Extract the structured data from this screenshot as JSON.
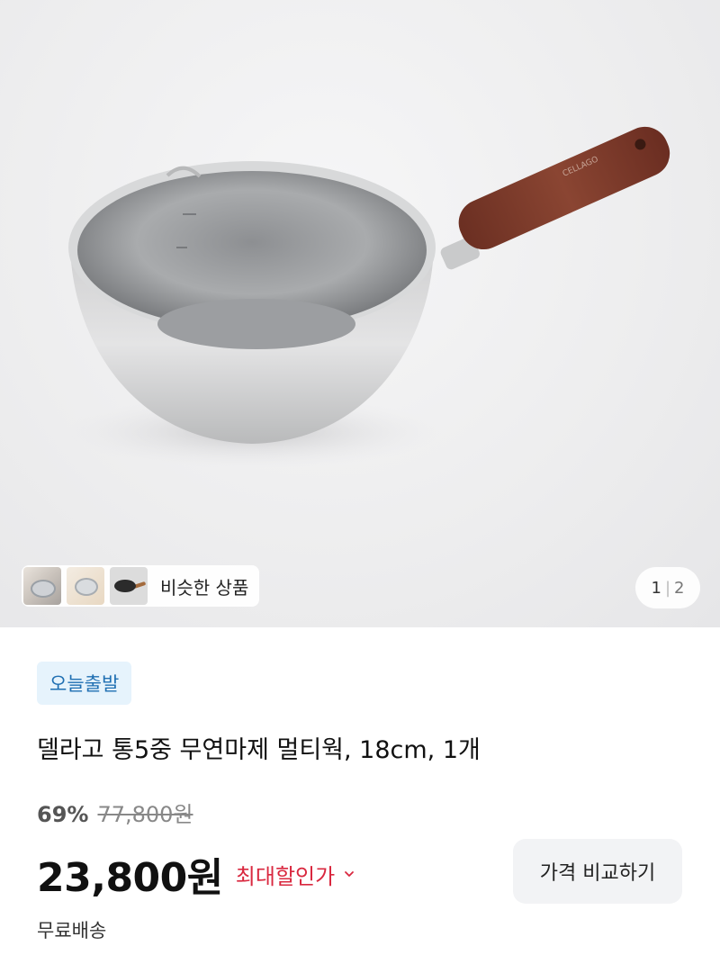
{
  "gallery": {
    "similar_label": "비슷한 상품",
    "pager": {
      "current": "1",
      "separator": "|",
      "total": "2"
    }
  },
  "product": {
    "badge": "오늘출발",
    "title": "델라고 통5중 무연마제 멀티웍, 18cm, 1개",
    "discount_rate": "69%",
    "original_price": "77,800원",
    "price": "23,800원",
    "max_discount_label": "최대할인가",
    "compare_button": "가격 비교하기",
    "shipping": "무료배송"
  },
  "colors": {
    "badge_bg": "#e6f3fc",
    "badge_text": "#1f6fb2",
    "max_discount": "#d9283f"
  }
}
